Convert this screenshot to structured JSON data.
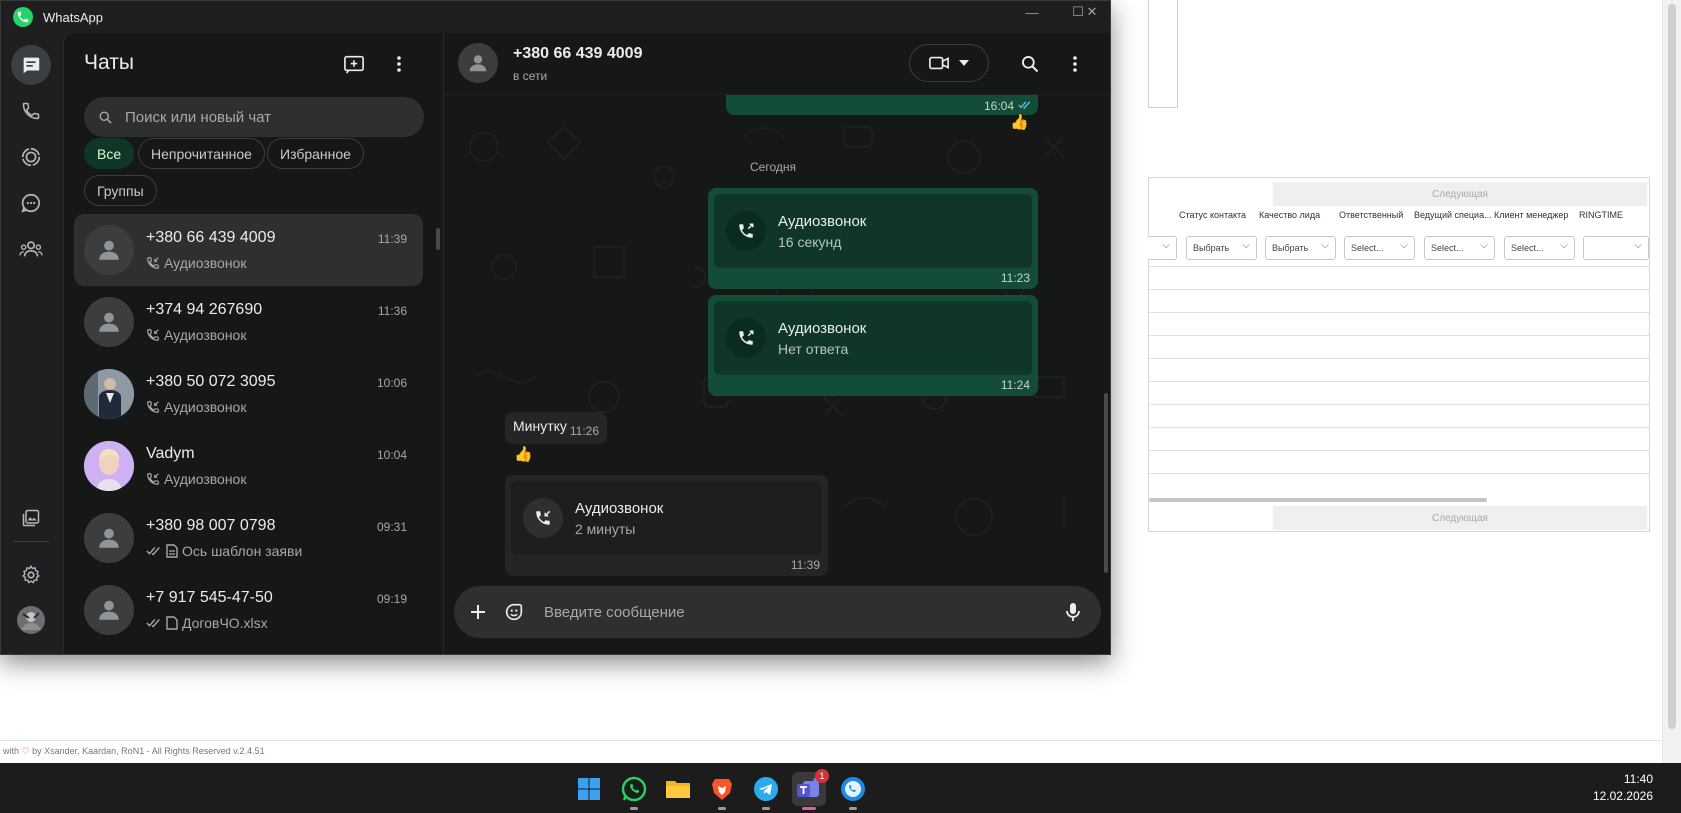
{
  "background_app": {
    "next_label": "Следующая",
    "columns": [
      "Статус контакта",
      "Качество лида",
      "Ответственный",
      "Ведущий специа...",
      "Клиент менеджер",
      "RINGTIME"
    ],
    "filters": [
      "Выбрать",
      "Выбрать",
      "Select...",
      "Select...",
      "Select..."
    ],
    "footer_prefix": "with",
    "footer_text": "by Xsander, Kaardan, RoN1 - All Rights Reserved v.2.4.51"
  },
  "window": {
    "title": "WhatsApp"
  },
  "chat_list": {
    "title": "Чаты",
    "search_placeholder": "Поиск или новый чат",
    "filters": [
      "Все",
      "Непрочитанное",
      "Избранное",
      "Группы"
    ],
    "chats": [
      {
        "name": "+380 66 439 4009",
        "time": "11:39",
        "last": "Аудиозвонок",
        "type": "call"
      },
      {
        "name": "+374 94 267690",
        "time": "11:36",
        "last": "Аудиозвонок",
        "type": "call"
      },
      {
        "name": "+380 50 072 3095",
        "time": "10:06",
        "last": "Аудиозвонок",
        "type": "call"
      },
      {
        "name": "Vadym",
        "time": "10:04",
        "last": "Аудиозвонок",
        "type": "call"
      },
      {
        "name": "+380 98 007 0798",
        "time": "09:31",
        "last": "Ось шаблон заяви",
        "type": "doc"
      },
      {
        "name": "+7 917 545-47-50",
        "time": "09:19",
        "last": "ДоговЧО.xlsx",
        "type": "doc"
      }
    ]
  },
  "conversation": {
    "contact": "+380 66 439 4009",
    "status": "в сети",
    "prev_time": "16:04",
    "date_label": "Сегодня",
    "messages": [
      {
        "title": "Аудиозвонок",
        "sub": "16 секунд",
        "time": "11:23"
      },
      {
        "title": "Аудиозвонок",
        "sub": "Нет ответа",
        "time": "11:24"
      },
      {
        "text": "Минутку",
        "time": "11:26"
      },
      {
        "title": "Аудиозвонок",
        "sub": "2 минуты",
        "time": "11:39"
      }
    ],
    "composer_placeholder": "Введите сообщение",
    "reaction": "👍"
  },
  "taskbar": {
    "time": "11:40",
    "date": "12.02.2026",
    "teams_badge": "1"
  },
  "colors": {
    "accent": "#25d366",
    "outgoing_bubble": "#144d37",
    "chip_active": "#103529"
  }
}
